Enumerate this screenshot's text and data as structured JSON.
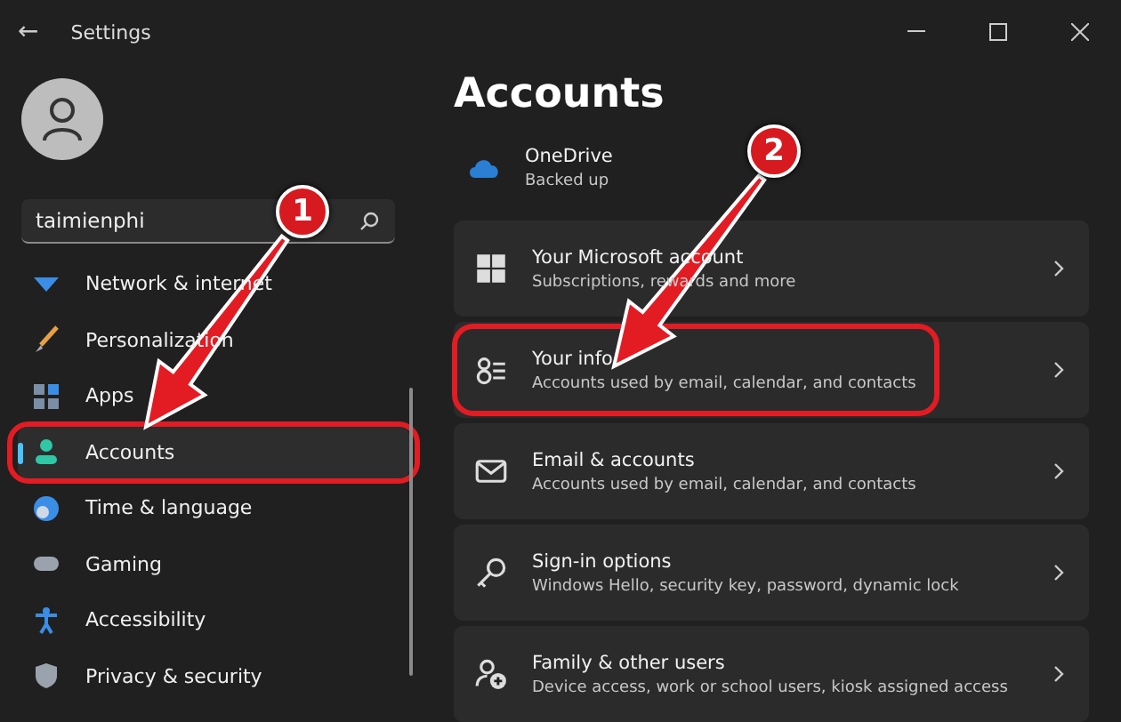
{
  "window": {
    "title": "Settings",
    "back": "←"
  },
  "search": {
    "value": "taimienphi"
  },
  "nav": [
    {
      "label": "Network & internet",
      "selected": false,
      "highlighted": false
    },
    {
      "label": "Personalization",
      "selected": false,
      "highlighted": false
    },
    {
      "label": "Apps",
      "selected": false,
      "highlighted": false
    },
    {
      "label": "Accounts",
      "selected": true,
      "highlighted": true
    },
    {
      "label": "Time & language",
      "selected": false,
      "highlighted": false
    },
    {
      "label": "Gaming",
      "selected": false,
      "highlighted": false
    },
    {
      "label": "Accessibility",
      "selected": false,
      "highlighted": false
    },
    {
      "label": "Privacy & security",
      "selected": false,
      "highlighted": false
    }
  ],
  "page": {
    "title": "Accounts"
  },
  "onedrive": {
    "title": "OneDrive",
    "status": "Backed up"
  },
  "cards": [
    {
      "title": "Your Microsoft account",
      "subtitle": "Subscriptions, rewards and more",
      "highlighted": false
    },
    {
      "title": "Your info",
      "subtitle": "Accounts used by email, calendar, and contacts",
      "highlighted": true
    },
    {
      "title": "Email & accounts",
      "subtitle": "Accounts used by email, calendar, and contacts",
      "highlighted": false
    },
    {
      "title": "Sign-in options",
      "subtitle": "Windows Hello, security key, password, dynamic lock",
      "highlighted": false
    },
    {
      "title": "Family & other users",
      "subtitle": "Device access, work or school users, kiosk assigned access",
      "highlighted": false
    }
  ],
  "callouts": [
    {
      "label": "1"
    },
    {
      "label": "2"
    }
  ]
}
